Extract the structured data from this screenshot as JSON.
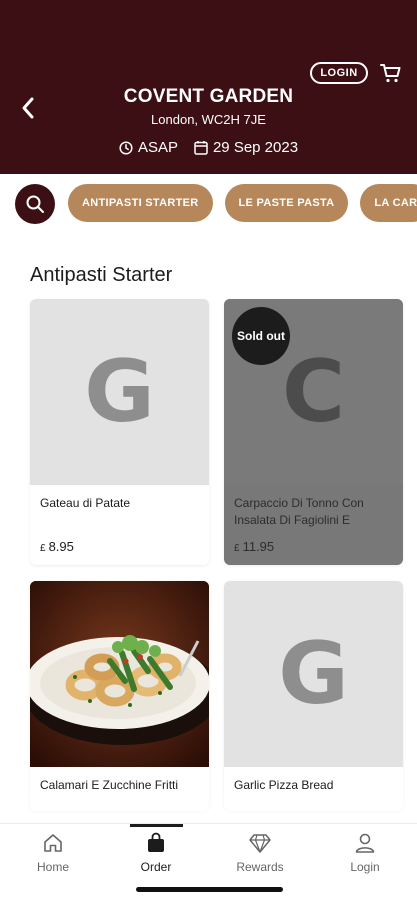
{
  "header": {
    "login_label": "LOGIN",
    "store_name": "COVENT GARDEN",
    "address": "London, WC2H 7JE",
    "time_label": "ASAP",
    "date_label": "29 Sep 2023",
    "background": "#3b0f14"
  },
  "categories": [
    {
      "label": "ANTIPASTI STARTER"
    },
    {
      "label": "LE PASTE PASTA"
    },
    {
      "label": "LA CAR"
    }
  ],
  "section": {
    "title": "Antipasti Starter"
  },
  "items": [
    {
      "name": "Gateau di Patate",
      "currency": "£",
      "price": "8.95",
      "placeholder": "G",
      "sold_out": false
    },
    {
      "name": "Carpaccio Di Tonno Con Insalata Di Fagiolini E",
      "currency": "£",
      "price": "11.95",
      "placeholder": "C",
      "sold_out": true,
      "badge": "Sold out"
    },
    {
      "name": "Calamari E Zucchine Fritti",
      "image": "photo of calamari and zucchini plate"
    },
    {
      "name": "Garlic Pizza Bread",
      "placeholder": "G"
    }
  ],
  "nav": [
    {
      "label": "Home",
      "icon": "home-icon"
    },
    {
      "label": "Order",
      "icon": "bag-icon",
      "active": true
    },
    {
      "label": "Rewards",
      "icon": "diamond-icon"
    },
    {
      "label": "Login",
      "icon": "user-icon"
    }
  ],
  "colors": {
    "brand": "#3b0f14",
    "chip": "#b5875a"
  }
}
